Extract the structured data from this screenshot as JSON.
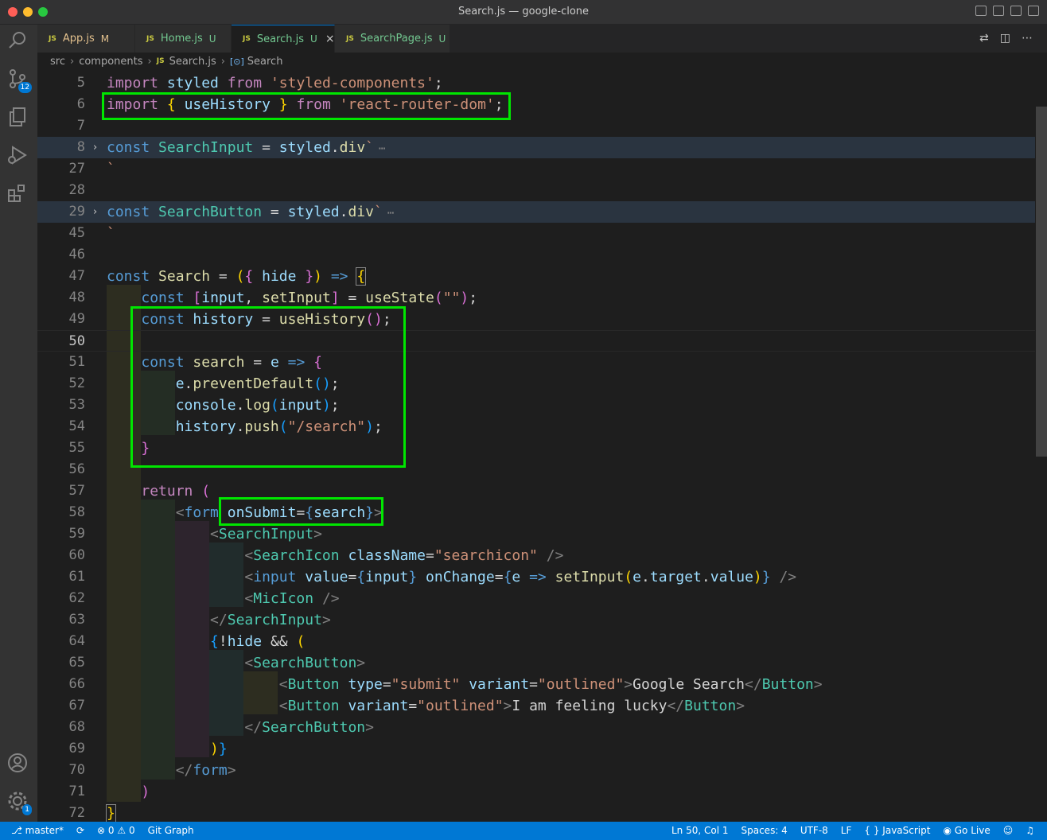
{
  "window": {
    "title": "Search.js — google-clone"
  },
  "activity": {
    "scm_badge": "12",
    "settings_badge": "1"
  },
  "tabs": [
    {
      "name": "App.js",
      "status": "M"
    },
    {
      "name": "Home.js",
      "status": "U"
    },
    {
      "name": "Search.js",
      "status": "U",
      "close": "×"
    },
    {
      "name": "SearchPage.js",
      "status": "U"
    }
  ],
  "file_icon_label": "JS",
  "breadcrumb": {
    "root": "src",
    "folder": "components",
    "file": "Search.js",
    "symbol": "Search"
  },
  "editor": {
    "lines": [
      {
        "n": "5",
        "code": "import styled from 'styled-components';"
      },
      {
        "n": "6",
        "code": "import { useHistory } from 'react-router-dom';"
      },
      {
        "n": "7",
        "code": ""
      },
      {
        "n": "8",
        "code": "const SearchInput = styled.div`"
      },
      {
        "n": "27",
        "code": "`"
      },
      {
        "n": "28",
        "code": ""
      },
      {
        "n": "29",
        "code": "const SearchButton = styled.div`"
      },
      {
        "n": "45",
        "code": "`"
      },
      {
        "n": "46",
        "code": ""
      },
      {
        "n": "47",
        "code": "const Search = ({ hide }) => {"
      },
      {
        "n": "48",
        "code": "    const [input, setInput] = useState(\"\");"
      },
      {
        "n": "49",
        "code": "    const history = useHistory();"
      },
      {
        "n": "50",
        "code": ""
      },
      {
        "n": "51",
        "code": "    const search = e => {"
      },
      {
        "n": "52",
        "code": "        e.preventDefault();"
      },
      {
        "n": "53",
        "code": "        console.log(input);"
      },
      {
        "n": "54",
        "code": "        history.push(\"/search\");"
      },
      {
        "n": "55",
        "code": "    }"
      },
      {
        "n": "56",
        "code": ""
      },
      {
        "n": "57",
        "code": "    return ("
      },
      {
        "n": "58",
        "code": "        <form onSubmit={search}>"
      },
      {
        "n": "59",
        "code": "            <SearchInput>"
      },
      {
        "n": "60",
        "code": "                <SearchIcon className=\"searchicon\" />"
      },
      {
        "n": "61",
        "code": "                <input value={input} onChange={e => setInput(e.target.value)} />"
      },
      {
        "n": "62",
        "code": "                <MicIcon />"
      },
      {
        "n": "63",
        "code": "            </SearchInput>"
      },
      {
        "n": "64",
        "code": "            {!hide && ("
      },
      {
        "n": "65",
        "code": "                <SearchButton>"
      },
      {
        "n": "66",
        "code": "                    <Button type=\"submit\" variant=\"outlined\">Google Search</Button>"
      },
      {
        "n": "67",
        "code": "                    <Button variant=\"outlined\">I am feeling lucky</Button>"
      },
      {
        "n": "68",
        "code": "                </SearchButton>"
      },
      {
        "n": "69",
        "code": "            )}"
      },
      {
        "n": "70",
        "code": "        </form>"
      },
      {
        "n": "71",
        "code": "    )"
      },
      {
        "n": "72",
        "code": "}"
      }
    ]
  },
  "statusbar": {
    "branch": "master*",
    "errors": "0",
    "warnings": "0",
    "git_graph": "Git Graph",
    "position": "Ln 50, Col 1",
    "spaces": "Spaces: 4",
    "encoding": "UTF-8",
    "eol": "LF",
    "language": "JavaScript",
    "go_live": "Go Live"
  },
  "colors": {
    "accent": "#0078d4",
    "highlight_box": "#00e600",
    "editor_bg": "#1e1e1e"
  }
}
